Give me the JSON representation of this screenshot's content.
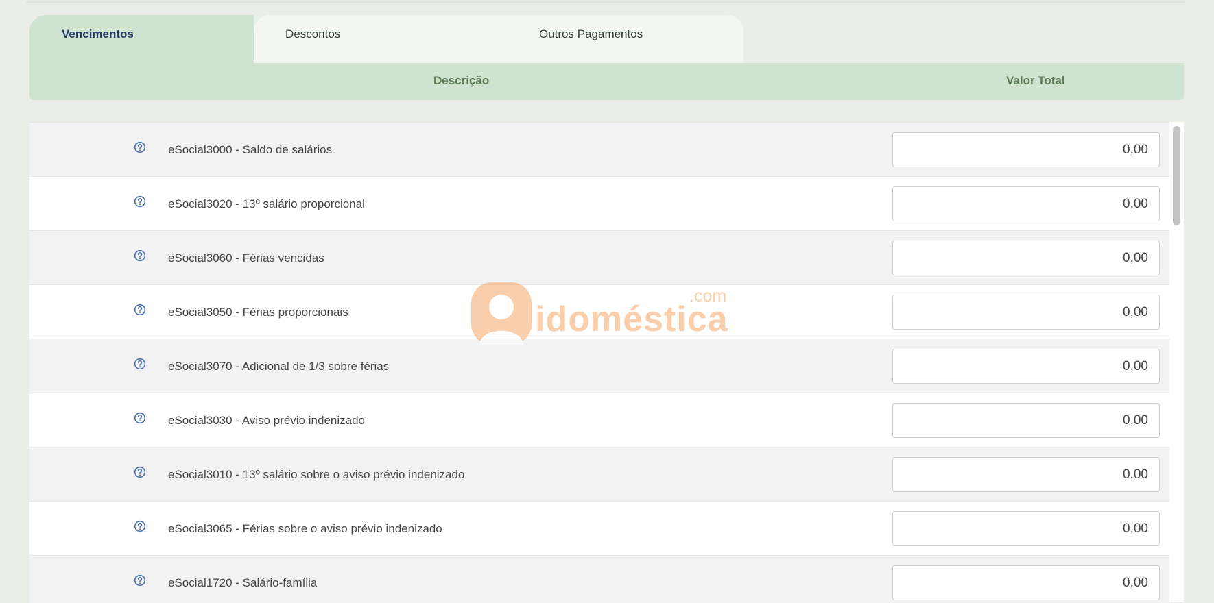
{
  "tabs": {
    "vencimentos": "Vencimentos",
    "descontos": "Descontos",
    "outros": "Outros Pagamentos"
  },
  "table": {
    "col_descricao": "Descrição",
    "col_valor": "Valor Total",
    "rows": [
      {
        "description": "eSocial3000 - Saldo de salários",
        "value": "0,00"
      },
      {
        "description": "eSocial3020 - 13º salário proporcional",
        "value": "0,00"
      },
      {
        "description": "eSocial3060 - Férias vencidas",
        "value": "0,00"
      },
      {
        "description": "eSocial3050 - Férias proporcionais",
        "value": "0,00"
      },
      {
        "description": "eSocial3070 - Adicional de 1/3 sobre férias",
        "value": "0,00"
      },
      {
        "description": "eSocial3030 - Aviso prévio indenizado",
        "value": "0,00"
      },
      {
        "description": "eSocial3010 - 13º salário sobre o aviso prévio indenizado",
        "value": "0,00"
      },
      {
        "description": "eSocial3065 - Férias sobre o aviso prévio indenizado",
        "value": "0,00"
      },
      {
        "description": "eSocial1720 - Salário-família",
        "value": "0,00"
      }
    ]
  },
  "icons": {
    "help": "help-circle-icon"
  },
  "watermark": {
    "brand": "idoméstica",
    "suffix": ".com"
  },
  "colors": {
    "accent_tab": "#cfe3d1",
    "active_tab_text": "#213a66",
    "header_text": "#5a7a55",
    "help_icon": "#4a6fb0",
    "watermark": "#f6a766"
  }
}
